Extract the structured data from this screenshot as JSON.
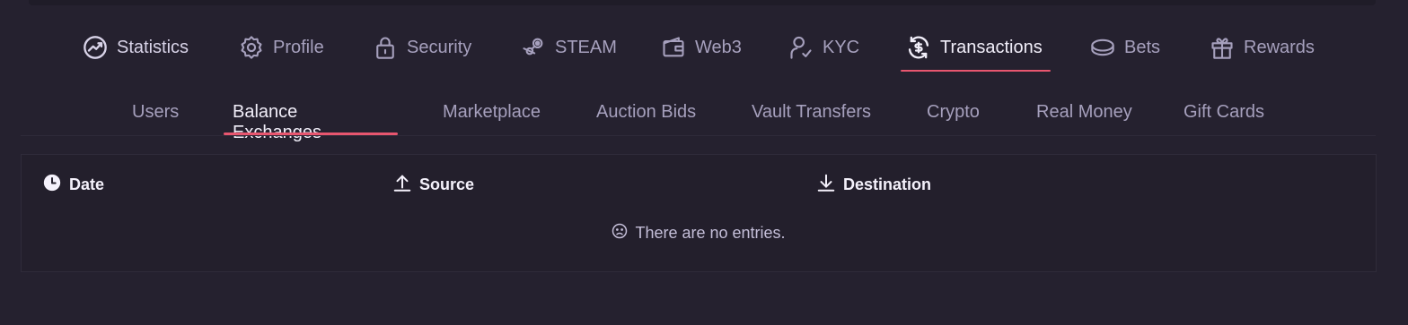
{
  "main_tabs": [
    {
      "label": "Statistics",
      "icon": "chart-circle-icon"
    },
    {
      "label": "Profile",
      "icon": "gear-icon"
    },
    {
      "label": "Security",
      "icon": "lock-icon"
    },
    {
      "label": "STEAM",
      "icon": "steam-icon"
    },
    {
      "label": "Web3",
      "icon": "wallet-icon"
    },
    {
      "label": "KYC",
      "icon": "user-check-icon"
    },
    {
      "label": "Transactions",
      "icon": "exchange-dollar-icon",
      "active": true
    },
    {
      "label": "Bets",
      "icon": "coin-icon"
    },
    {
      "label": "Rewards",
      "icon": "gift-icon"
    }
  ],
  "sub_tabs": [
    {
      "label": "Users"
    },
    {
      "label": "Balance Exchanges",
      "active": true
    },
    {
      "label": "Marketplace"
    },
    {
      "label": "Auction Bids"
    },
    {
      "label": "Vault Transfers"
    },
    {
      "label": "Crypto"
    },
    {
      "label": "Real Money"
    },
    {
      "label": "Gift Cards"
    }
  ],
  "table": {
    "columns": [
      {
        "label": "Date",
        "icon": "clock-icon"
      },
      {
        "label": "Source",
        "icon": "upload-icon"
      },
      {
        "label": "Destination",
        "icon": "download-icon"
      }
    ],
    "empty_message": "There are no entries."
  },
  "colors": {
    "background": "#25212f",
    "accent": "#e8566f",
    "text_muted": "#a6a0bd",
    "text_active": "#f1eef9"
  }
}
